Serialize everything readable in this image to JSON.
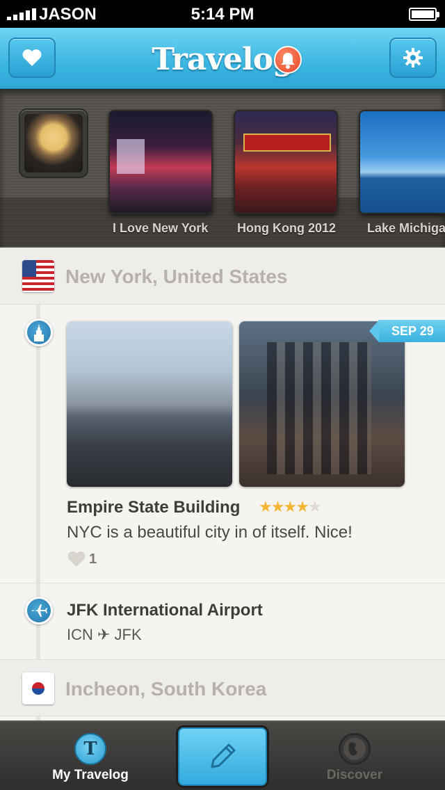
{
  "status_bar": {
    "carrier": "JASON",
    "time": "5:14 PM"
  },
  "nav": {
    "title": "Travelog",
    "left_icon": "heart-icon",
    "right_icon": "gear-icon",
    "notification_icon": "bell-icon"
  },
  "albums": [
    {
      "label": "I Love New York"
    },
    {
      "label": "Hong Kong 2012"
    },
    {
      "label": "Lake Michiga"
    }
  ],
  "feed": {
    "sections": [
      {
        "title": "New York, United States",
        "flag": "us-flag"
      },
      {
        "title": "Incheon, South Korea",
        "flag": "kr-flag"
      }
    ],
    "entry": {
      "date": "SEP 29",
      "title": "Empire State Building",
      "rating": 4,
      "rating_max": 5,
      "text": "NYC is a beautiful city in of itself. Nice!",
      "likes": "1"
    },
    "flight": {
      "title": "JFK International Airport",
      "route": "ICN ✈ JFK"
    }
  },
  "tab_bar": {
    "my_travelog": "My Travelog",
    "discover": "Discover",
    "compose_icon": "pencil-icon"
  },
  "colors": {
    "accent": "#3bb6e2",
    "star": "#f2b634"
  }
}
